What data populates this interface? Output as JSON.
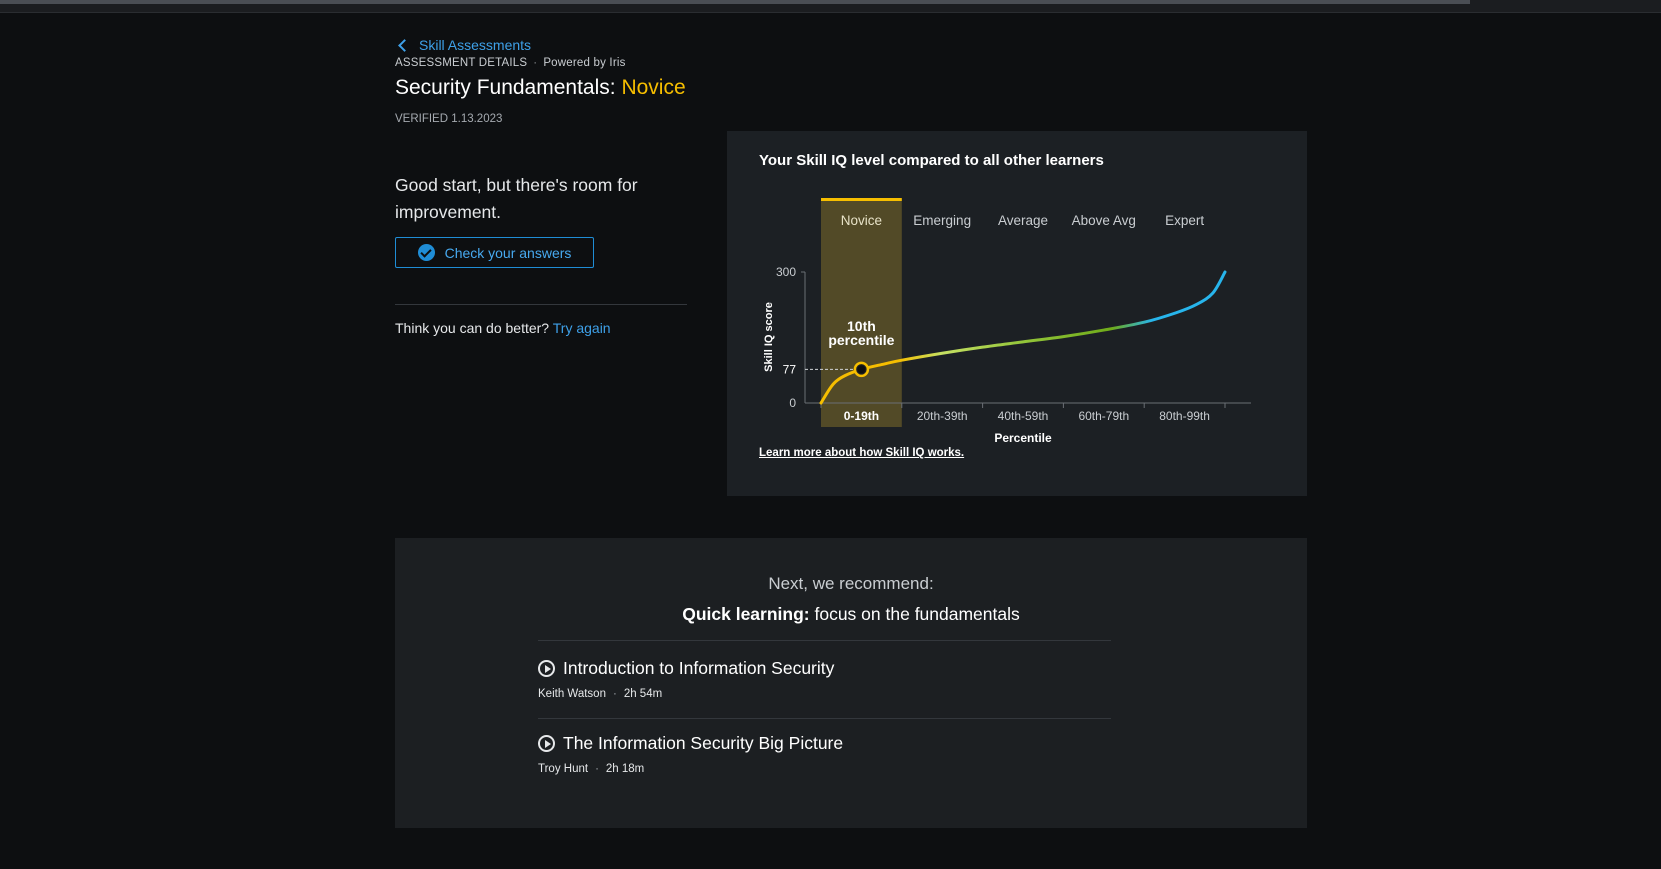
{
  "nav": {
    "back_label": "Skill Assessments"
  },
  "header": {
    "section_label": "ASSESSMENT DETAILS",
    "powered_by": "Powered by Iris",
    "title_prefix": "Security Fundamentals:",
    "title_level": "Novice",
    "verified": "VERIFIED 1.13.2023"
  },
  "result": {
    "feedback": "Good start, but there's room for improvement.",
    "check_button": "Check your answers",
    "retry_prompt": "Think you can do better?",
    "retry_link": "Try again"
  },
  "chart_card": {
    "title": "Your Skill IQ level compared to all other learners",
    "learn_more": "Learn more about how Skill IQ works."
  },
  "chart_data": {
    "type": "line",
    "levels": [
      "Novice",
      "Emerging",
      "Average",
      "Above Avg",
      "Expert"
    ],
    "categories": [
      "0-19th",
      "20th-39th",
      "40th-59th",
      "60th-79th",
      "80th-99th"
    ],
    "highlighted_level": "Novice",
    "xlabel": "Percentile",
    "ylabel": "Skill IQ score",
    "yticks": [
      0,
      300
    ],
    "ylim": [
      0,
      300
    ],
    "xlim": [
      0,
      100
    ],
    "marker": {
      "percentile": 10,
      "score": 77,
      "label": "10th percentile"
    },
    "curve": {
      "x": [
        0,
        3,
        6,
        10,
        15,
        20,
        30,
        40,
        50,
        60,
        70,
        80,
        88,
        93,
        97,
        100
      ],
      "y": [
        0,
        43,
        63,
        77,
        88,
        98,
        114,
        128,
        140,
        152,
        167,
        185,
        207,
        226,
        252,
        300
      ]
    },
    "colors": {
      "novice": "#f6be00",
      "emerging": "#c5e063",
      "average": "#93c53a",
      "above_avg": "#6fab1a",
      "expert": "#27b5ec",
      "highlight_band": "#524a27"
    }
  },
  "recommend": {
    "heading": "Next, we recommend:",
    "subheading_bold": "Quick learning:",
    "subheading_rest": "focus on the fundamentals",
    "courses": [
      {
        "title": "Introduction to Information Security",
        "author": "Keith Watson",
        "duration": "2h 54m"
      },
      {
        "title": "The Information Security Big Picture",
        "author": "Troy Hunt",
        "duration": "2h 18m"
      }
    ]
  }
}
